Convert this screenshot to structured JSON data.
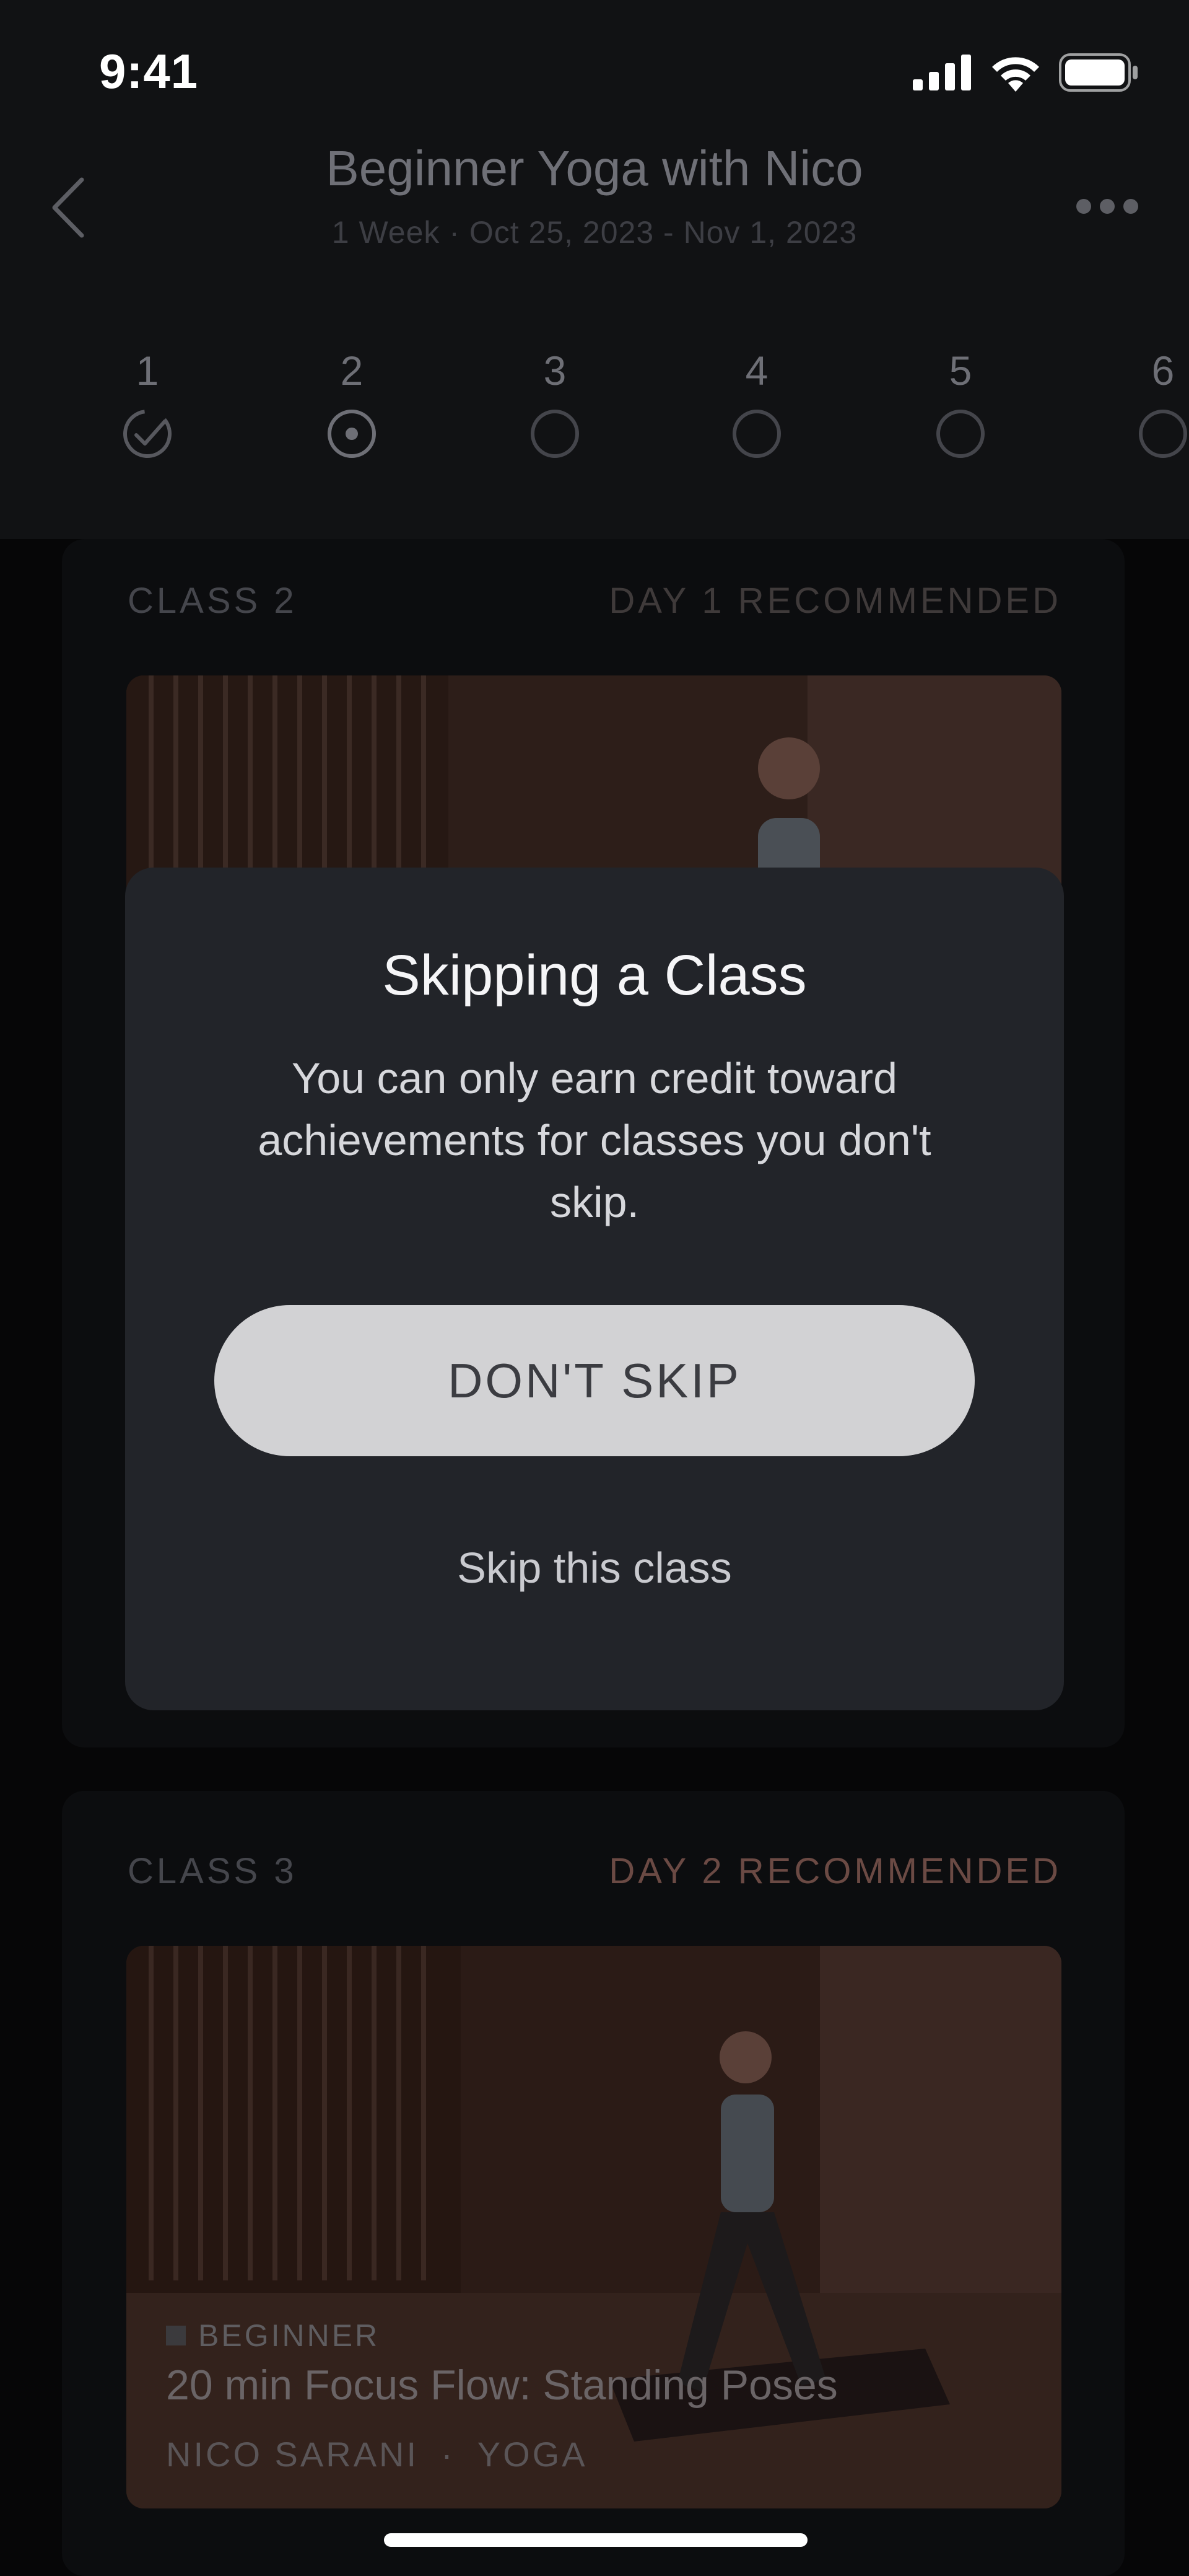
{
  "status": {
    "time": "9:41"
  },
  "header": {
    "title": "Beginner Yoga with Nico",
    "subtitle": "1 Week  ·  Oct 25, 2023 - Nov 1, 2023"
  },
  "weeks": [
    {
      "num": "1",
      "state": "done"
    },
    {
      "num": "2",
      "state": "current"
    },
    {
      "num": "3",
      "state": "todo"
    },
    {
      "num": "4",
      "state": "todo"
    },
    {
      "num": "5",
      "state": "todo"
    },
    {
      "num": "6",
      "state": "todo"
    }
  ],
  "classes": [
    {
      "label": "CLASS 2",
      "rec": "DAY 1 RECOMMENDED"
    },
    {
      "label": "CLASS 3",
      "rec": "DAY 2 RECOMMENDED",
      "level": "BEGINNER",
      "title": "20 min Focus Flow: Standing Poses",
      "instructor": "NICO SARANI",
      "category": "YOGA"
    }
  ],
  "modal": {
    "title": "Skipping a Class",
    "body": "You can only earn credit toward achievements for classes you don't skip.",
    "primary": "DON'T SKIP",
    "secondary": "Skip this class"
  },
  "colors": {
    "rec_accent_class3": "#6b4a44",
    "modal_bg": "#222429",
    "primary_button": "#d2d2d4"
  }
}
